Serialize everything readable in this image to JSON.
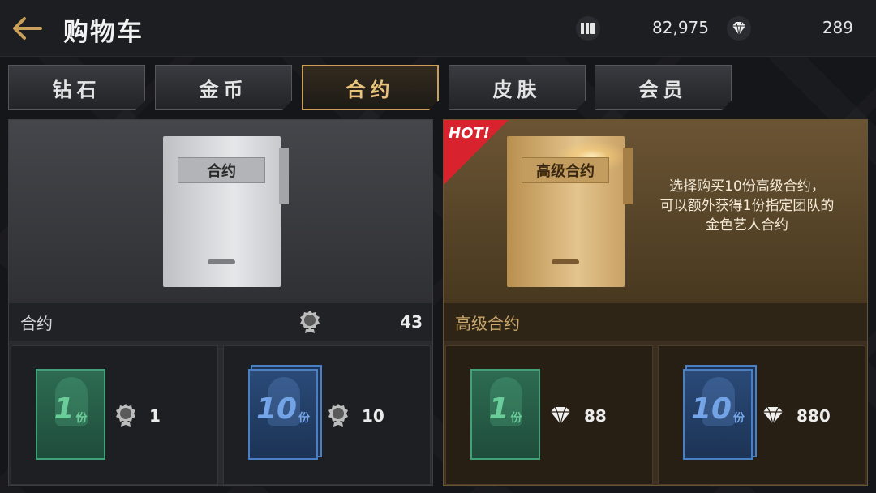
{
  "header": {
    "title": "购物车",
    "coins": "82,975",
    "diamonds": "289",
    "coin_icon": "coin-stack-icon",
    "diamond_icon": "diamond-icon"
  },
  "tabs": [
    {
      "label": "钻石",
      "active": false
    },
    {
      "label": "金币",
      "active": false
    },
    {
      "label": "合约",
      "active": true
    },
    {
      "label": "皮肤",
      "active": false
    },
    {
      "label": "会员",
      "active": false
    }
  ],
  "panels": {
    "standard": {
      "doc_label": "合约",
      "name": "合约",
      "owned_icon": "medal-icon",
      "owned": "43",
      "options": [
        {
          "num": "1",
          "unit": "份",
          "price": "1",
          "price_icon": "medal-icon"
        },
        {
          "num": "10",
          "unit": "份",
          "price": "10",
          "price_icon": "medal-icon"
        }
      ]
    },
    "premium": {
      "badge": "HOT!",
      "doc_label": "高级合约",
      "name": "高级合约",
      "promo_lines": [
        "选择购买10份高级合约，",
        "可以额外获得1份指定团队的",
        "金色艺人合约"
      ],
      "options": [
        {
          "num": "1",
          "unit": "份",
          "price": "88",
          "price_icon": "diamond-icon"
        },
        {
          "num": "10",
          "unit": "份",
          "price": "880",
          "price_icon": "diamond-icon"
        }
      ]
    }
  },
  "colors": {
    "accent_gold": "#c9a05a",
    "hot_red": "#d8232f",
    "card_green": "#3fa278",
    "card_blue": "#4b7fc3"
  }
}
